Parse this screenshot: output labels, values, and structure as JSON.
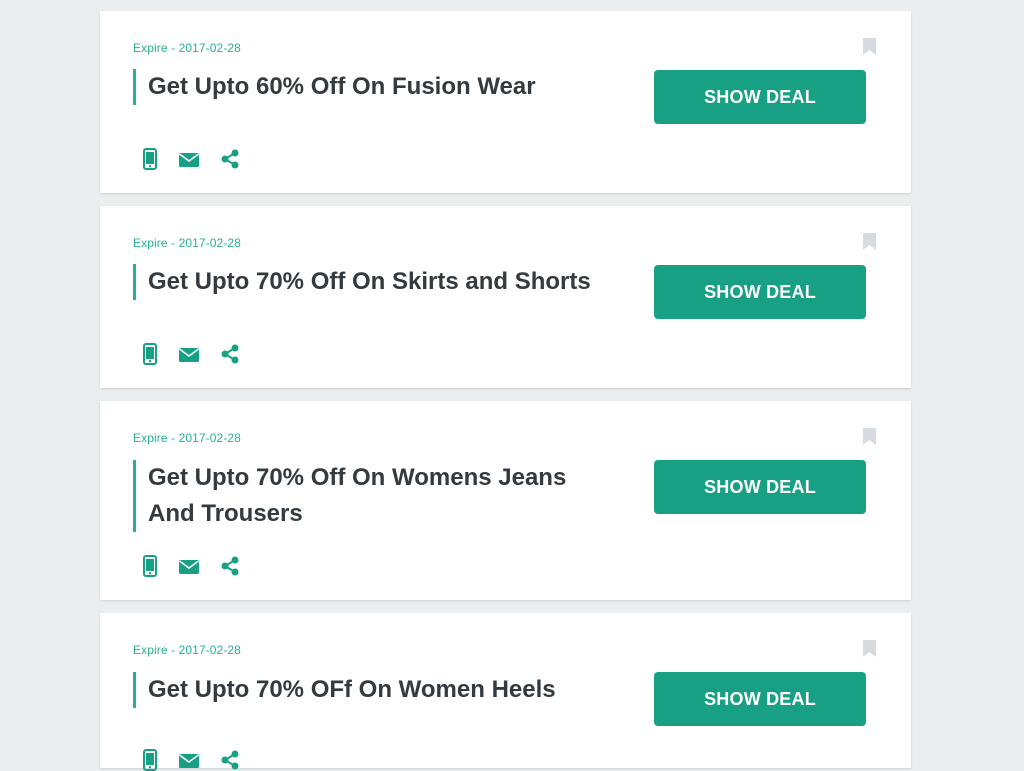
{
  "colors": {
    "accent": "#18a085",
    "accent_light": "#26b194",
    "bookmark": "#d5dbe0",
    "background": "#eaeef0",
    "card": "#ffffff",
    "title_text": "#333a40"
  },
  "deals": [
    {
      "expire": "Expire - 2017-02-28",
      "title": "Get Upto 60% Off On Fusion Wear",
      "button_label": "SHOW DEAL",
      "icons": [
        "mobile-icon",
        "envelope-icon",
        "share-icon"
      ],
      "bookmark_icon": "bookmark-icon"
    },
    {
      "expire": "Expire - 2017-02-28",
      "title": "Get Upto 70% Off On Skirts and Shorts",
      "button_label": "SHOW DEAL",
      "icons": [
        "mobile-icon",
        "envelope-icon",
        "share-icon"
      ],
      "bookmark_icon": "bookmark-icon"
    },
    {
      "expire": "Expire - 2017-02-28",
      "title": "Get Upto 70% Off On Womens Jeans And Trousers",
      "button_label": "SHOW DEAL",
      "icons": [
        "mobile-icon",
        "envelope-icon",
        "share-icon"
      ],
      "bookmark_icon": "bookmark-icon"
    },
    {
      "expire": "Expire - 2017-02-28",
      "title": "Get Upto 70% OFf On Women Heels",
      "button_label": "SHOW DEAL",
      "icons": [
        "mobile-icon",
        "envelope-icon",
        "share-icon"
      ],
      "bookmark_icon": "bookmark-icon"
    }
  ]
}
